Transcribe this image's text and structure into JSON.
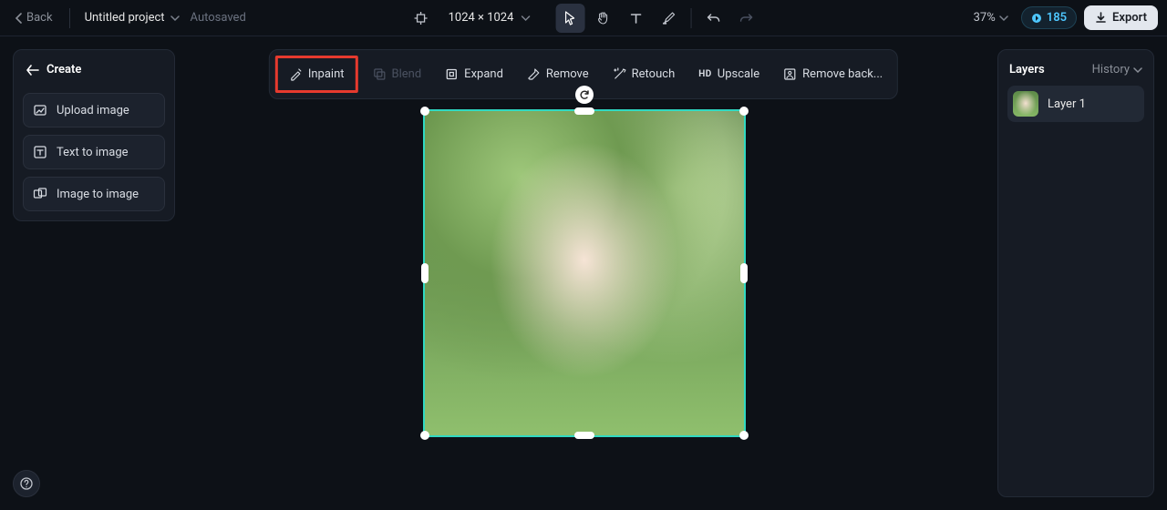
{
  "header": {
    "back_label": "Back",
    "project_name": "Untitled project",
    "autosave_label": "Autosaved",
    "dimensions": "1024 × 1024",
    "zoom_label": "37%",
    "credits_value": "185",
    "export_label": "Export"
  },
  "create_panel": {
    "title": "Create",
    "items": [
      {
        "label": "Upload image"
      },
      {
        "label": "Text to image"
      },
      {
        "label": "Image to image"
      }
    ]
  },
  "action_bar": {
    "items": [
      {
        "label": "Inpaint",
        "highlighted": true,
        "disabled": false
      },
      {
        "label": "Blend",
        "highlighted": false,
        "disabled": true
      },
      {
        "label": "Expand",
        "highlighted": false,
        "disabled": false
      },
      {
        "label": "Remove",
        "highlighted": false,
        "disabled": false
      },
      {
        "label": "Retouch",
        "highlighted": false,
        "disabled": false
      },
      {
        "label": "Upscale",
        "highlighted": false,
        "disabled": false,
        "prefix": "HD"
      },
      {
        "label": "Remove back...",
        "highlighted": false,
        "disabled": false
      }
    ]
  },
  "layers_panel": {
    "title": "Layers",
    "history_label": "History",
    "layers": [
      {
        "label": "Layer 1"
      }
    ]
  },
  "canvas": {
    "selection": {
      "border_color": "#30d9c2"
    }
  }
}
